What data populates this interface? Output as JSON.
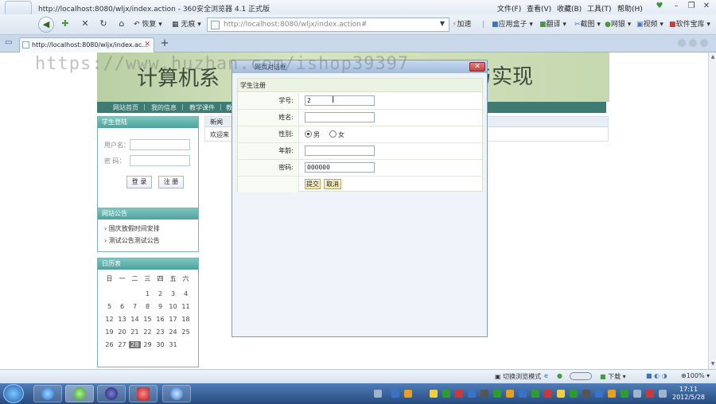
{
  "browser": {
    "window_title": "http://localhost:8080/wljx/index.action - 360安全浏览器 4.1 正式版",
    "menu": [
      "文件(F)",
      "查看(V)",
      "收藏(B)",
      "工具(T)",
      "帮助(H)"
    ],
    "toolbar": {
      "restore_label": "恢复",
      "no_trace_label": "无痕",
      "speedup_label": "加速",
      "app_box_label": "应用盒子",
      "translate_label": "翻译",
      "screenshot_label": "截图",
      "netbank_label": "网银",
      "video_label": "视频",
      "software_label": "软件宝库"
    },
    "address_url": "http://localhost:8080/wljx/index.action#",
    "tab_label": "http://localhost:8080/wljx/index.ac...",
    "status": {
      "switch_mode": "切换浏览模式",
      "download": "下载",
      "zoom": "100%"
    }
  },
  "page": {
    "banner_title": "计算机系",
    "banner_title_right": "与实现",
    "nav": [
      "网站首页",
      "我的信息",
      "教学课件",
      "教"
    ],
    "login": {
      "head": "学生登陆",
      "username_label": "用户名：",
      "password_label": "密    码：",
      "login_btn": "登 录",
      "register_btn": "注 册"
    },
    "notice": {
      "head": "网站公告",
      "items": [
        "国庆放假时间安排",
        "测试公告测试公告"
      ]
    },
    "calendar": {
      "head": "日历表",
      "weekdays": [
        "日",
        "一",
        "二",
        "三",
        "四",
        "五",
        "六"
      ],
      "rows": [
        [
          "",
          "",
          "",
          "1",
          "2",
          "3",
          "4",
          "5"
        ],
        [
          "6",
          "7",
          "8",
          "9",
          "10",
          "11",
          "12"
        ],
        [
          "13",
          "14",
          "15",
          "16",
          "17",
          "18",
          "19"
        ],
        [
          "20",
          "21",
          "22",
          "23",
          "24",
          "25",
          "26"
        ],
        [
          "27",
          "28",
          "29",
          "30",
          "31",
          "",
          ""
        ]
      ],
      "today": "28"
    },
    "news": {
      "head": "新闻",
      "welcome": "欢迎来"
    }
  },
  "dialog": {
    "title": "网页对话框",
    "form_head": "学生注册",
    "fields": {
      "student_no_label": "学号:",
      "student_no_value": "2",
      "name_label": "姓名:",
      "name_value": "",
      "gender_label": "性别:",
      "gender_male": "男",
      "gender_female": "女",
      "age_label": "年龄:",
      "age_value": "",
      "password_label": "密码:",
      "password_value": "000000"
    },
    "submit_label": "提交",
    "cancel_label": "取消"
  },
  "watermark": "https://www.huzhan.com/ishop39397",
  "taskbar": {
    "clock_time": "17:11",
    "clock_date": "2012/5/28"
  }
}
